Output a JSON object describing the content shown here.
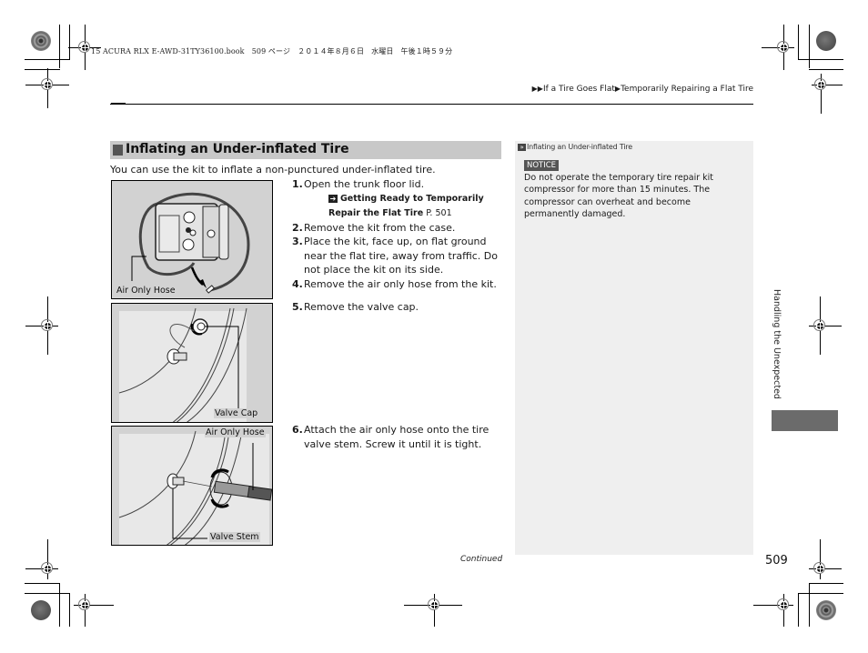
{
  "print_header": "15 ACURA RLX E-AWD-31TY36100.book　509 ページ　２０１４年８月６日　水曜日　午後１時５９分",
  "breadcrumb": {
    "prefix_icon": "double-triangle-right",
    "items": [
      "If a Tire Goes Flat",
      "Temporarily Repairing a Flat Tire"
    ],
    "separator_icon": "triangle-right"
  },
  "section": {
    "title": "Inflating an Under-inflated Tire",
    "intro": "You can use the kit to inflate a non-punctured under-inflated tire."
  },
  "steps": [
    {
      "num": "1.",
      "text": "Open the trunk floor lid.",
      "ref": {
        "icon": "reference-arrow",
        "bold": "Getting Ready to Temporarily Repair the Flat Tire",
        "page": "P. 501"
      }
    },
    {
      "num": "2.",
      "text": "Remove the kit from the case."
    },
    {
      "num": "3.",
      "text": "Place the kit, face up, on flat ground near the flat tire, away from traffic. Do not place the kit on its side."
    },
    {
      "num": "4.",
      "text": "Remove the air only hose from the kit."
    },
    {
      "num": "5.",
      "text": "Remove the valve cap."
    },
    {
      "num": "6.",
      "text": "Attach the air only hose onto the tire valve stem. Screw it until it is tight."
    }
  ],
  "figures": [
    {
      "labels": [
        "Air Only Hose"
      ]
    },
    {
      "labels": [
        "Valve Cap"
      ]
    },
    {
      "labels": [
        "Air Only Hose",
        "Valve Stem"
      ]
    }
  ],
  "sidebar": {
    "title": "Inflating an Under-inflated Tire",
    "notice_label": "NOTICE",
    "notice_text": "Do not operate the temporary tire repair kit compressor for more than 15 minutes. The compressor can overheat and become permanently damaged."
  },
  "chapter_tab": "Handling the Unexpected",
  "footer": {
    "continued": "Continued",
    "page_number": "509"
  },
  "colors": {
    "section_header_bg": "#c8c8c8",
    "sidebar_bg": "#efefef",
    "notice_bg": "#555555",
    "chapter_tab_block": "#6b6b6b",
    "figure_bg": "#d2d2d2"
  }
}
